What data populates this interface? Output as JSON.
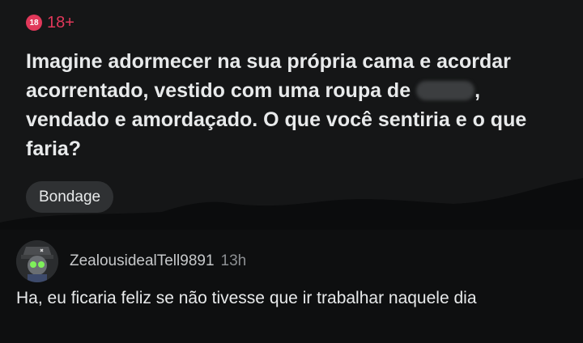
{
  "post": {
    "nsfw_badge": {
      "icon_text": "18",
      "label": "18+",
      "color": "#e0385a",
      "icon": "nsfw-18-icon"
    },
    "title_part1": "Imagine adormecer na sua própria cama e acordar acorrentado, vestido com uma roupa de ",
    "title_part2": ", vendado e amordaçado. O que você sentiria e o que faria?",
    "flair": "Bondage"
  },
  "comment": {
    "avatar_icon": "user-avatar-icon",
    "username": "ZealousidealTell9891",
    "time": "13h",
    "text": "Ha, eu ficaria feliz se não tivesse que ir trabalhar naquele dia"
  }
}
